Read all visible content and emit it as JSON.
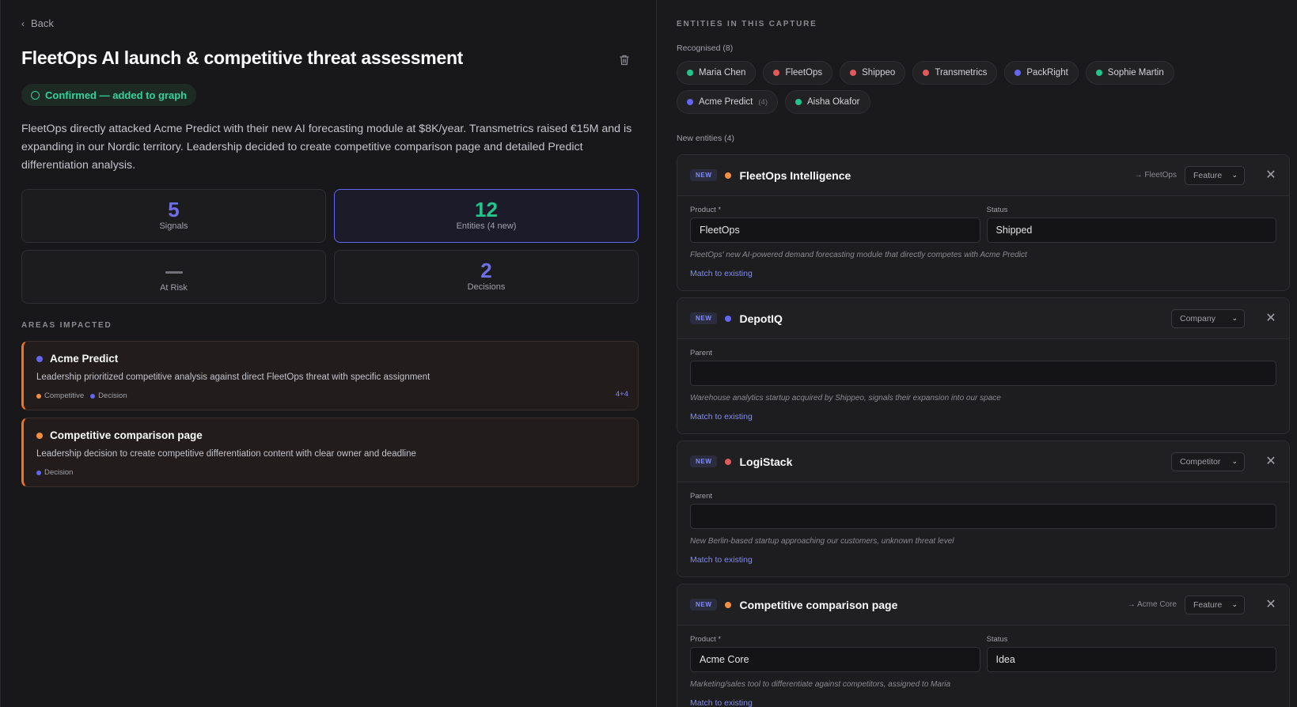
{
  "nav": {
    "back_label": "Back"
  },
  "header": {
    "title": "FleetOps AI launch & competitive threat assessment",
    "status": "Confirmed — added to graph"
  },
  "summary": "FleetOps directly attacked Acme Predict with their new AI forecasting module at $8K/year. Transmetrics raised €15M and is expanding in our Nordic territory. Leadership decided to create competitive comparison page and detailed Predict differentiation analysis.",
  "stats": {
    "signals": {
      "value": "5",
      "label": "Signals"
    },
    "entities": {
      "value": "12",
      "label": "Entities (4 new)"
    },
    "at_risk": {
      "value": "",
      "label": "At Risk"
    },
    "decisions": {
      "value": "2",
      "label": "Decisions"
    }
  },
  "areas": {
    "label": "AREAS IMPACTED",
    "items": [
      {
        "name": "Acme Predict",
        "desc": "Leadership prioritized competitive analysis against direct FleetOps threat with specific assignment",
        "tag1": "Competitive",
        "tag2": "Decision",
        "count": "4+4"
      },
      {
        "name": "Competitive comparison page",
        "desc": "Leadership decision to create competitive differentiation content with clear owner and deadline",
        "tag1": "Decision"
      }
    ]
  },
  "entities": {
    "heading": "ENTITIES IN THIS CAPTURE",
    "recognised_label": "Recognised (8)",
    "recognised": [
      {
        "name": "Maria Chen",
        "color": "#22c58b"
      },
      {
        "name": "FleetOps",
        "color": "#e05a5a"
      },
      {
        "name": "Shippeo",
        "color": "#e05a5a"
      },
      {
        "name": "Transmetrics",
        "color": "#e05a5a"
      },
      {
        "name": "PackRight",
        "color": "#6366f1"
      },
      {
        "name": "Sophie Martin",
        "color": "#22c58b"
      },
      {
        "name": "Acme Predict",
        "color": "#6366f1",
        "count": "(4)"
      },
      {
        "name": "Aisha Okafor",
        "color": "#22c58b"
      }
    ],
    "new_label": "New entities (4)",
    "new_badge": "NEW",
    "match_label": "Match to existing",
    "cards": [
      {
        "name": "FleetOps Intelligence",
        "color": "#f59042",
        "link": "→ FleetOps",
        "type": "Feature",
        "f1_label": "Product *",
        "f1_value": "FleetOps",
        "f2_label": "Status",
        "f2_value": "Shipped",
        "desc": "FleetOps' new AI-powered demand forecasting module that directly competes with Acme Predict"
      },
      {
        "name": "DepotIQ",
        "color": "#6366f1",
        "type": "Company",
        "f1_label": "Parent",
        "f1_value": "",
        "desc": "Warehouse analytics startup acquired by Shippeo, signals their expansion into our space"
      },
      {
        "name": "LogiStack",
        "color": "#e05a5a",
        "type": "Competitor",
        "f1_label": "Parent",
        "f1_value": "",
        "desc": "New Berlin-based startup approaching our customers, unknown threat level"
      },
      {
        "name": "Competitive comparison page",
        "color": "#f59042",
        "link": "→ Acme Core",
        "type": "Feature",
        "f1_label": "Product *",
        "f1_value": "Acme Core",
        "f2_label": "Status",
        "f2_value": "Idea",
        "desc": "Marketing/sales tool to differentiate against competitors, assigned to Maria"
      }
    ]
  },
  "colors": {
    "accent": "#6366f1",
    "success": "#22c58b",
    "warning": "#f97316"
  }
}
